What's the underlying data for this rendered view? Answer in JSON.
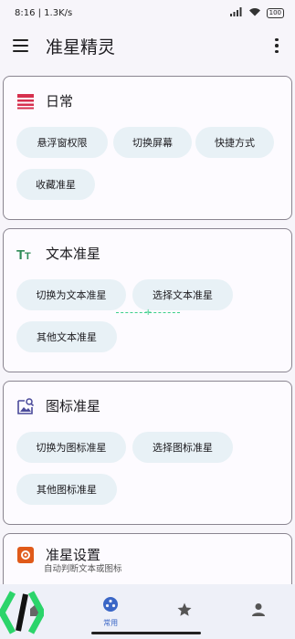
{
  "status_bar": {
    "time_speed": "8:16 | 1.3K/s",
    "battery": "100"
  },
  "app_bar": {
    "title": "准星精灵",
    "menu_icon": "menu-icon",
    "more_icon": "more-vert-icon"
  },
  "cards": {
    "daily": {
      "title": "日常",
      "icon": "list-icon",
      "chips": [
        "悬浮窗权限",
        "切换屏幕",
        "快捷方式",
        "收藏准星"
      ]
    },
    "text": {
      "title": "文本准星",
      "icon": "text-format-icon",
      "chips": [
        "切换为文本准星",
        "选择文本准星",
        "其他文本准星"
      ]
    },
    "icon": {
      "title": "图标准星",
      "icon": "image-search-icon",
      "chips": [
        "切换为图标准星",
        "选择图标准星",
        "其他图标准星"
      ]
    },
    "settings": {
      "title": "准星设置",
      "subtitle": "自动判断文本或图标",
      "icon": "settings-icon"
    }
  },
  "bottom_nav": {
    "items": [
      {
        "label": "",
        "icon": "home-icon"
      },
      {
        "label": "常用",
        "icon": "common-icon",
        "active": true
      },
      {
        "label": "",
        "icon": "star-icon"
      },
      {
        "label": "",
        "icon": "person-icon"
      }
    ]
  },
  "colors": {
    "accent": "#3a66c6",
    "chip_bg": "#e8f1f6",
    "daily_icon": "#d6304e",
    "text_icon": "#2e8b57",
    "icon_icon": "#4a4a9a",
    "settings_icon": "#e05a1a"
  }
}
